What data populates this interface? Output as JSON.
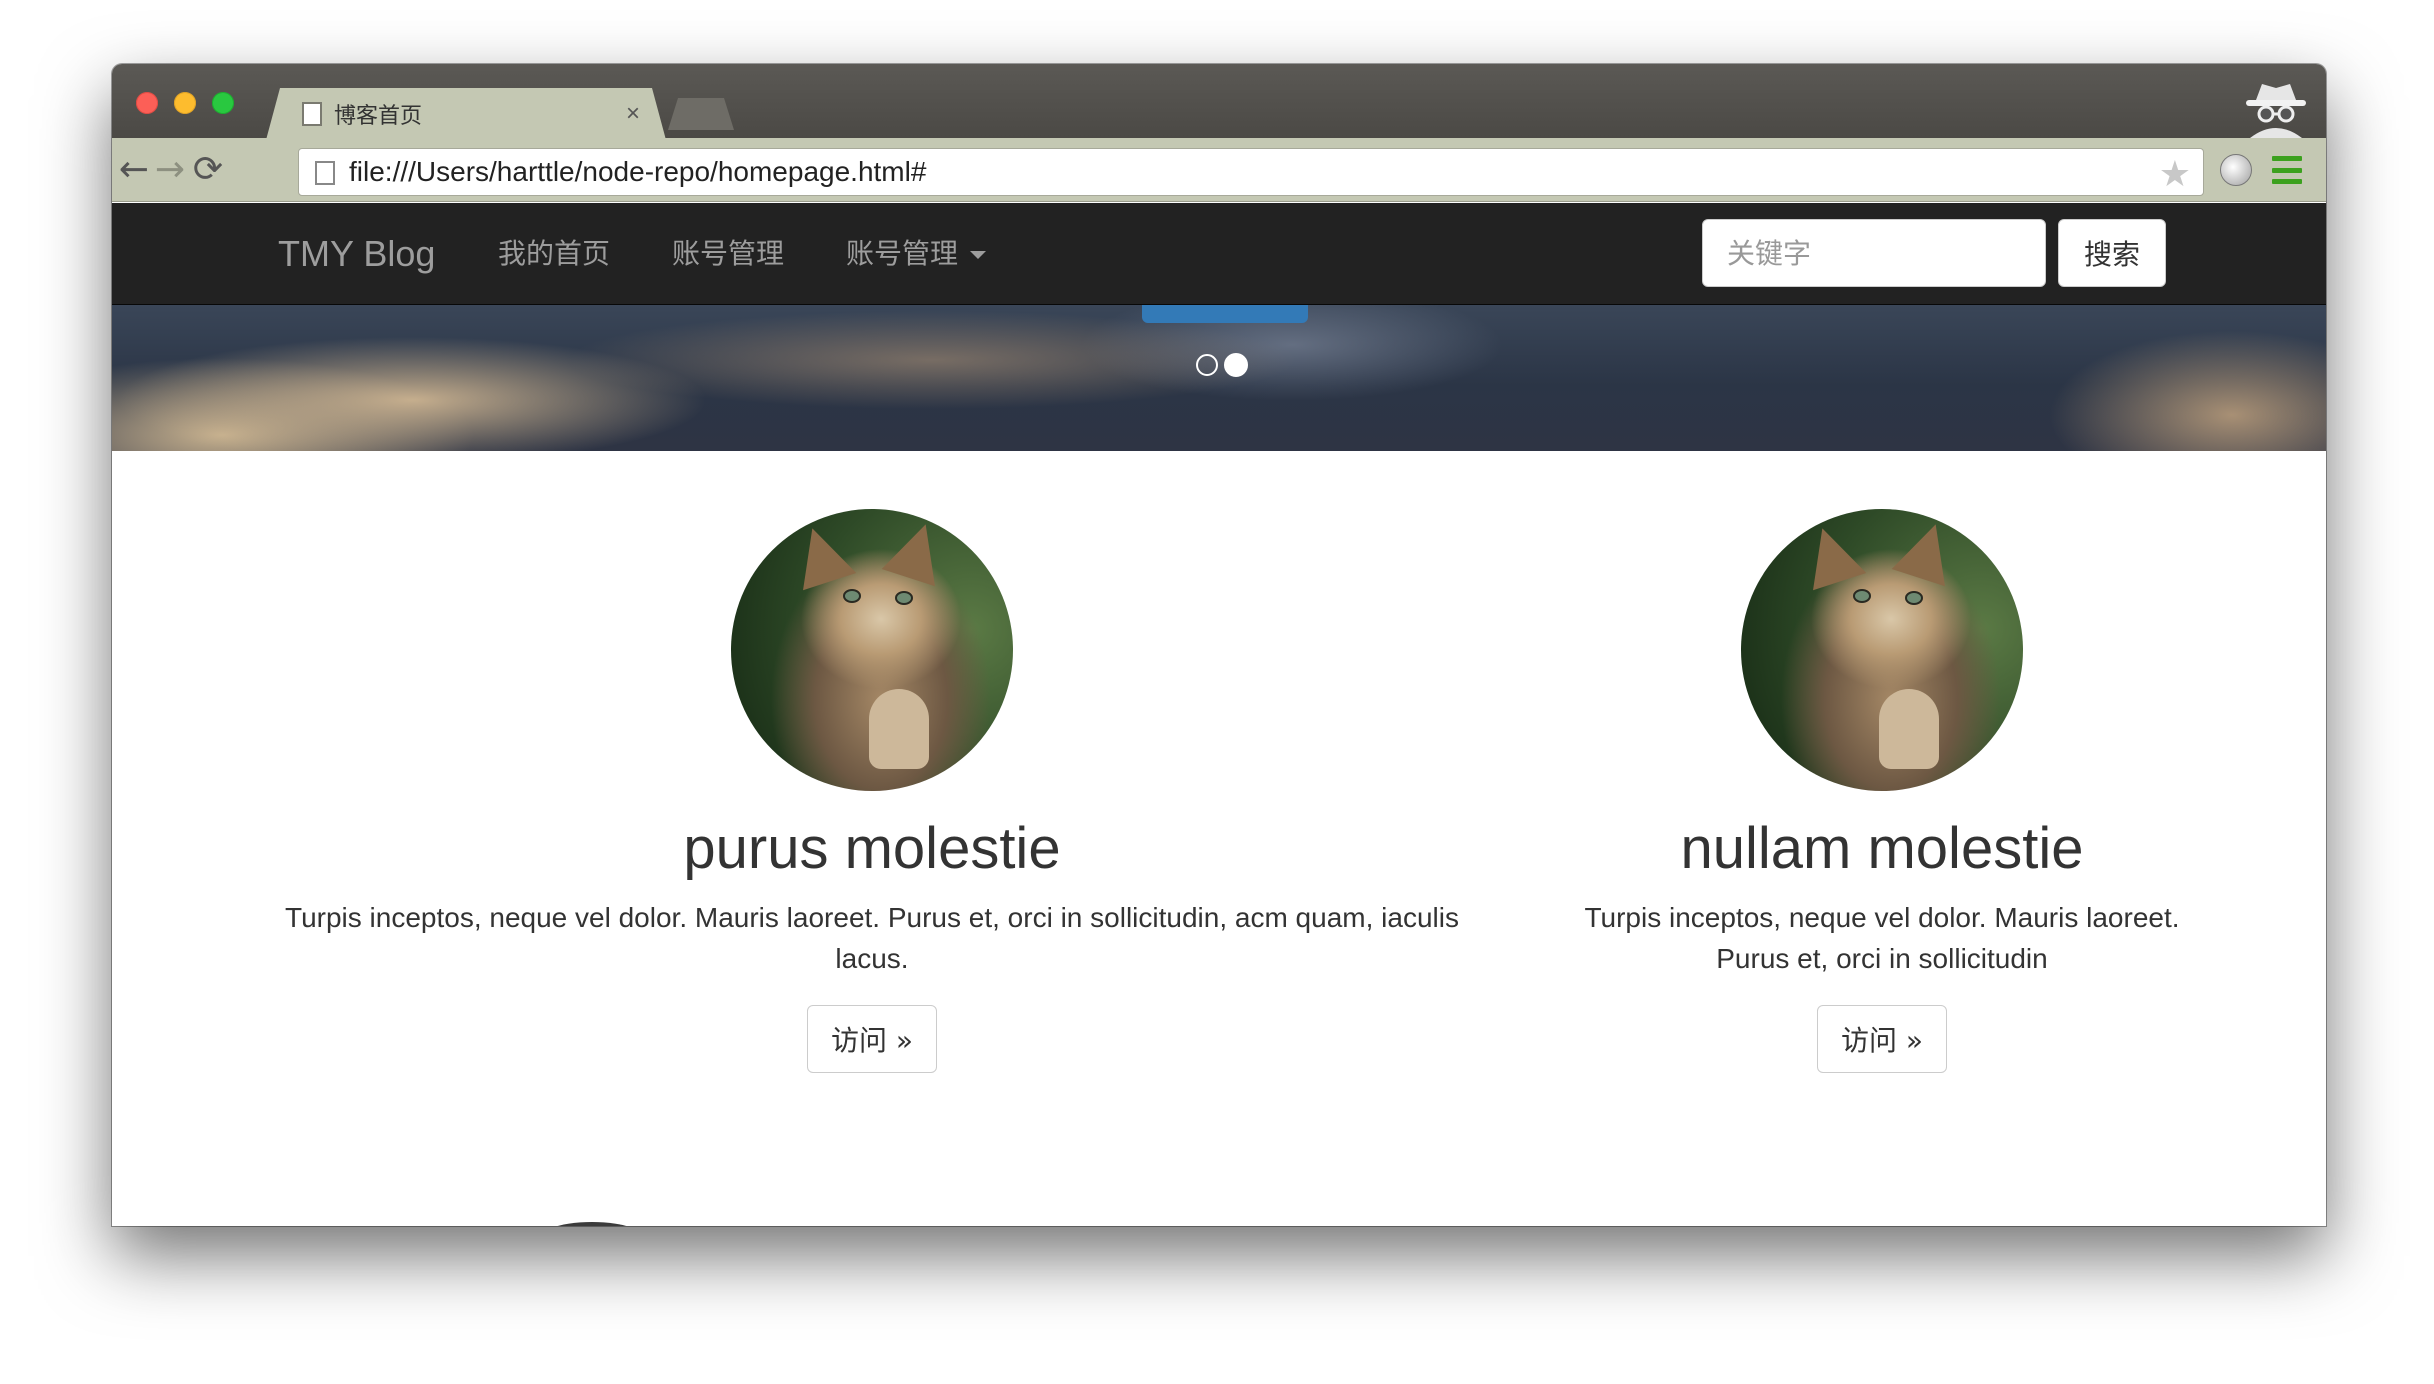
{
  "browser": {
    "tab_title": "博客首页",
    "tab_close": "×",
    "url": "file:///Users/harttle/node-repo/homepage.html#",
    "back_glyph": "←",
    "forward_glyph": "→",
    "reload_glyph": "⟳",
    "star_glyph": "★"
  },
  "navbar": {
    "brand": "TMY Blog",
    "links": [
      "我的首页",
      "账号管理",
      "账号管理"
    ],
    "search_placeholder": "关键字",
    "search_button": "搜索"
  },
  "carousel": {
    "indicators": 2,
    "active_index": 1
  },
  "columns": [
    {
      "title": "purus molestie",
      "text": "Turpis inceptos, neque vel dolor. Mauris laoreet. Purus et, orci in sollicitudin, acm quam, iaculis lacus.",
      "button": "访问 »"
    },
    {
      "title": "nullam molestie",
      "text": "Turpis inceptos, neque vel dolor. Mauris laoreet. Purus et, orci in sollicitudin",
      "button": "访问 »"
    }
  ],
  "colors": {
    "navbar_bg": "#222222",
    "nav_text": "#9d9d9d",
    "primary": "#337ab7",
    "chrome_bg": "#c4c8b3"
  }
}
